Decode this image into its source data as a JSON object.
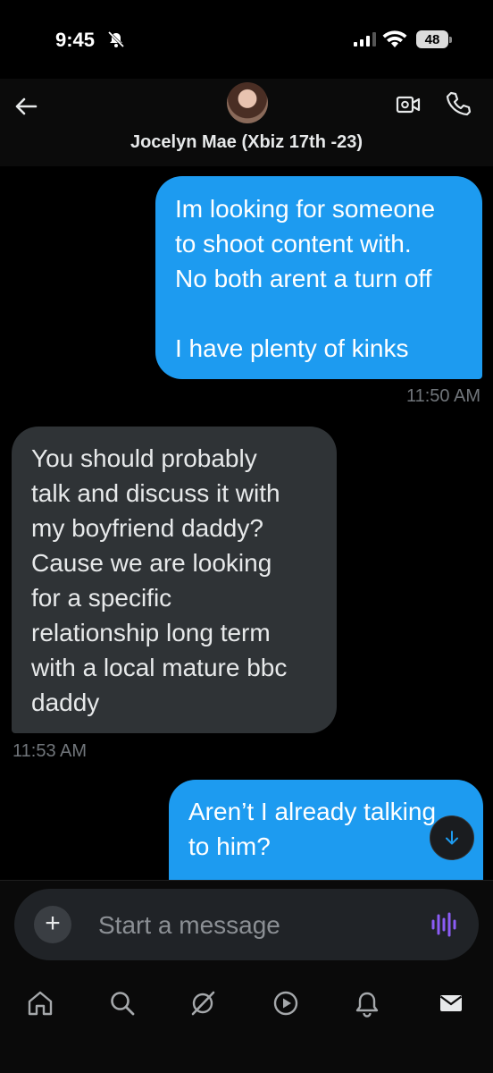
{
  "status_bar": {
    "time": "9:45",
    "battery": "48"
  },
  "header": {
    "contact_name": "Jocelyn Mae (Xbiz 17th -23)"
  },
  "messages": [
    {
      "direction": "sent",
      "lines": [
        "Im looking for someone",
        "to shoot content with.",
        "No both arent a turn off",
        "",
        "I have plenty of kinks"
      ],
      "time": "11:50 AM"
    },
    {
      "direction": "received",
      "lines": [
        "You should probably",
        "talk and discuss it with",
        "my boyfriend daddy?",
        "Cause we are looking",
        "for a specific",
        "relationship long term",
        "with a local mature bbc",
        "daddy"
      ],
      "time": "11:53 AM"
    },
    {
      "direction": "sent",
      "lines": [
        "Aren’t I already talking",
        "to him?"
      ]
    }
  ],
  "composer": {
    "placeholder": "Start a message"
  },
  "tabs": [
    "home-icon",
    "search-icon",
    "grok-icon",
    "play-icon",
    "notifications-icon",
    "messages-icon"
  ],
  "colors": {
    "sent_bubble": "#1d9bf0",
    "received_bubble": "#2f3336",
    "voice_accent": "#8b5cf6"
  }
}
